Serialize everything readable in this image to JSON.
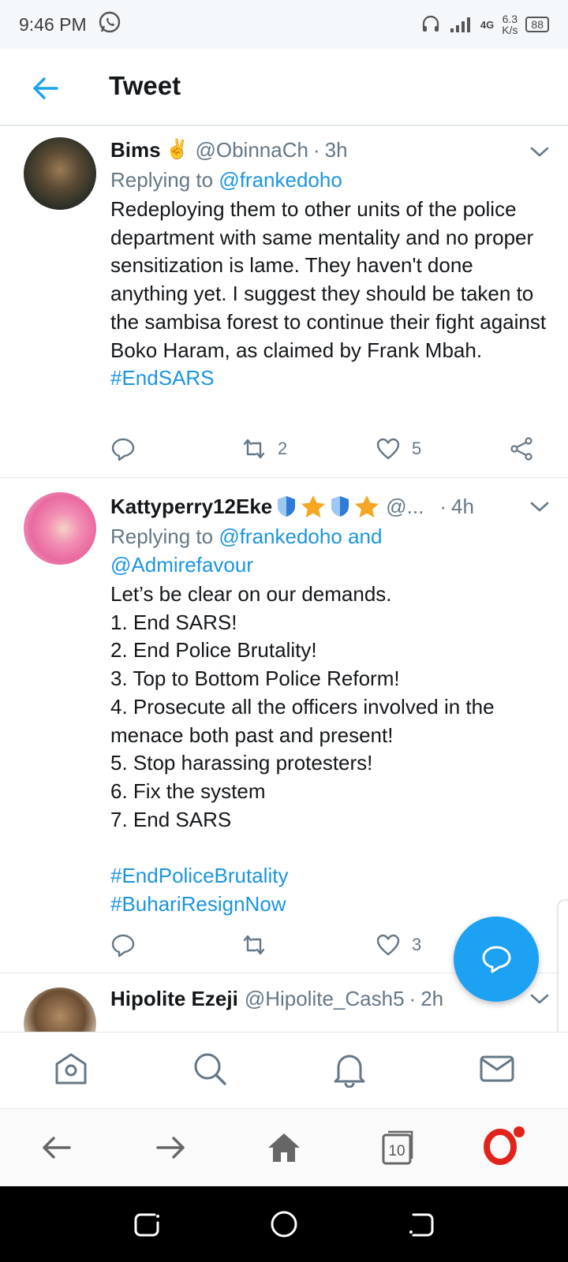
{
  "status_bar": {
    "time": "9:46 PM",
    "network": "4G",
    "speed_value": "6.3",
    "speed_unit": "K/s",
    "battery": "88"
  },
  "header": {
    "title": "Tweet"
  },
  "tweets": [
    {
      "name": "Bims",
      "emoji": "✌️",
      "handle": "@ObinnaCh",
      "age": "3h",
      "reply_prefix": "Replying to ",
      "reply_to": "@frankedoho",
      "text": "Redeploying them to other units of the police department with same mentality and no proper sensitization is lame. They haven't done anything yet. I suggest they should be taken to the sambisa forest to continue their fight against Boko Haram, as claimed by Frank Mbah.",
      "hashtags": "#EndSARS",
      "retweets": "2",
      "likes": "5"
    },
    {
      "name": "Kattyperry12Eke",
      "handle": "@...",
      "age": "4h",
      "reply_prefix": "Replying to ",
      "reply_to": "@frankedoho and @Admirefavour",
      "text": "Let’s be clear on our demands.\n1. End SARS!\n2. End Police Brutality!\n3. Top to Bottom Police Reform!\n4. Prosecute all the officers involved in the menace both past and present!\n5. Stop harassing protesters!\n6. Fix the system\n7. End SARS",
      "hashtags_1": "#EndPoliceBrutality",
      "hashtags_2": "#BuhariResignNow",
      "retweets": "",
      "likes": "3"
    },
    {
      "name": "Hipolite Ezeji",
      "handle": "@Hipolite_Cash5",
      "age": "2h"
    }
  ],
  "browser": {
    "tab_count": "10"
  },
  "colors": {
    "accent": "#1da1f2",
    "link": "#1b95e0",
    "muted": "#657786",
    "opera_red": "#e1241b"
  }
}
